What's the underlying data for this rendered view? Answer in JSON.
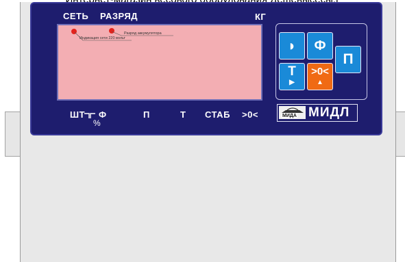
{
  "page_caption": "Интернет-магазин весового оборудования Дешевысесы.г",
  "panel": {
    "top_labels": {
      "network": "СЕТЬ",
      "discharge": "РАЗРЯД",
      "unit": "КГ"
    },
    "display": {
      "annotation_battery": "Разряд аккумулятора",
      "annotation_mains": "Индикация сети 220 вольт"
    },
    "bottom_labels": {
      "pcs": "ШТ",
      "percent": "%",
      "phi": "Ф",
      "p": "П",
      "t": "Т",
      "stab": "СТАБ",
      "zero": ">0<"
    },
    "keys": {
      "power_label": "◗",
      "phi_label": "Ф",
      "tare_label": "Т",
      "tare_arrow": "▶",
      "zero_label": ">0<",
      "zero_arrow": "▲",
      "p_label": "П"
    },
    "logo": {
      "badge_text": "МИДА",
      "brand_text": "МИДЛ"
    }
  },
  "colors": {
    "panel_blue": "#1e1d6e",
    "display_pink": "#f3aeb3",
    "key_blue": "#1a8ad8",
    "key_orange": "#f06a14",
    "led_red": "#e3231c"
  }
}
